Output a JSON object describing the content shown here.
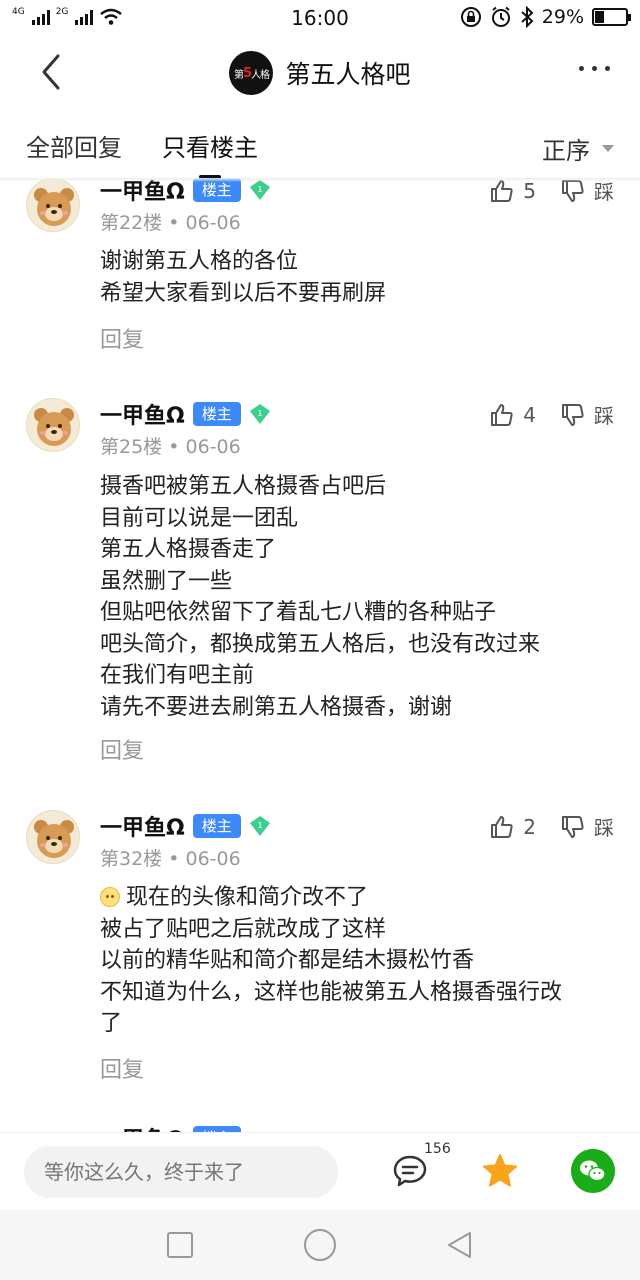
{
  "status_bar": {
    "network_left": "4G",
    "network_right": "2G",
    "time": "16:00",
    "battery": "29%",
    "battery_level": 0.29
  },
  "header": {
    "forum_logo_text_a": "第",
    "forum_logo_text_b": "5",
    "forum_logo_text_c": "人格",
    "title": "第五人格吧"
  },
  "tabs": {
    "all_replies": "全部回复",
    "op_only": "只看楼主",
    "sort": "正序"
  },
  "posts": [
    {
      "author": "一甲鱼Ω",
      "badge": "楼主",
      "level": "1",
      "floor": "第22楼",
      "date": "06-06",
      "lines": [
        "谢谢第五人格的各位",
        "希望大家看到以后不要再刷屏"
      ],
      "likes": "5",
      "dislike": "踩",
      "reply": "回复"
    },
    {
      "author": "一甲鱼Ω",
      "badge": "楼主",
      "level": "1",
      "floor": "第25楼",
      "date": "06-06",
      "lines": [
        "摄香吧被第五人格摄香占吧后",
        "目前可以说是一团乱",
        "第五人格摄香走了",
        "虽然删了一些",
        "但贴吧依然留下了着乱七八糟的各种贴子",
        "吧头简介，都换成第五人格后，也没有改过来",
        "在我们有吧主前",
        "请先不要进去刷第五人格摄香，谢谢"
      ],
      "likes": "4",
      "dislike": "踩",
      "reply": "回复"
    },
    {
      "author": "一甲鱼Ω",
      "badge": "楼主",
      "level": "1",
      "floor": "第32楼",
      "date": "06-06",
      "lines": [
        "现在的头像和简介改不了",
        "被占了贴吧之后就改成了这样",
        "以前的精华贴和简介都是结木摄松竹香",
        "不知道为什么，这样也能被第五人格摄香强行改",
        "了"
      ],
      "likes": "2",
      "dislike": "踩",
      "reply": "回复"
    },
    {
      "author": "一甲鱼Ω",
      "badge": "楼主"
    }
  ],
  "bottom_bar": {
    "reply_placeholder": "等你这么久，终于来了",
    "comment_count": "156"
  },
  "icons": {
    "back": "chevron-left-icon",
    "more": "more-dots-icon",
    "like": "thumbs-up-icon",
    "dislike": "thumbs-down-icon",
    "comment": "comment-bubble-icon",
    "favorite": "star-icon",
    "share": "wechat-icon",
    "nav_recent": "square-icon",
    "nav_home": "circle-icon",
    "nav_back": "triangle-back-icon"
  },
  "colors": {
    "op_badge": "#3d8af7",
    "level_badge": "#3ccf8e",
    "star": "#f7a41c",
    "wechat": "#1aad19"
  }
}
